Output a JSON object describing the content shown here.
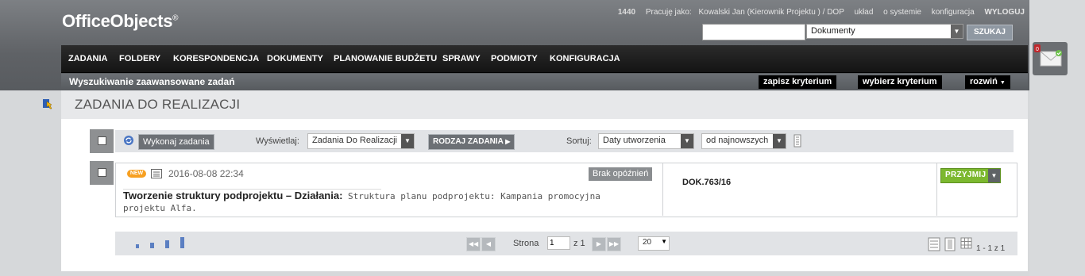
{
  "app": {
    "logo": "OfficeObjects",
    "logo_mark": "®"
  },
  "userbar": {
    "count": "1440",
    "working_as_label": "Pracuję jako:",
    "user": "Kowalski Jan (Kierownik Projektu ) / DOP",
    "layout": "układ",
    "about": "o systemie",
    "config": "konfiguracja",
    "logout": "WYLOGUJ"
  },
  "search": {
    "input_value": "",
    "scope_selected": "Dokumenty",
    "button": "SZUKAJ"
  },
  "nav": {
    "items": [
      "ZADANIA",
      "FOLDERY",
      "KORESPONDENCJA",
      "DOKUMENTY",
      "PLANOWANIE BUDŻETU",
      "SPRAWY",
      "PODMIOTY",
      "KONFIGURACJA"
    ]
  },
  "subbar": {
    "title": "Wyszukiwanie zaawansowane zadań",
    "save_criteria": "zapisz kryterium",
    "choose_criteria": "wybierz kryterium",
    "expand": "rozwiń"
  },
  "notifications": {
    "count": "0"
  },
  "page": {
    "title": "ZADANIA DO REALIZACJI"
  },
  "toolbar": {
    "execute_button": "Wykonaj zadania",
    "display_label": "Wyświetlaj:",
    "display_selected": "Zadania Do Realizacji",
    "task_type_button": "RODZAJ ZADANIA",
    "sort_label": "Sortuj:",
    "sort_by_selected": "Daty utworzenia",
    "sort_order_selected": "od najnowszych"
  },
  "tasks": [
    {
      "badge": "NEW",
      "date": "2016-08-08 22:34",
      "delay_status": "Brak opóźnień",
      "title": "Tworzenie struktury podprojektu – Działania:",
      "description": " Struktura planu podprojektu: Kampania promocyjna projektu Alfa.",
      "doc_ref": "DOK.763/16",
      "action": "PRZYJMIJ"
    }
  ],
  "pager": {
    "page_label": "Strona",
    "page_value": "1",
    "of_label": "z 1",
    "per_page_selected": "20",
    "summary": "1 - 1 z 1"
  },
  "colors": {
    "accept_green": "#7cb82f",
    "new_badge_orange": "#f7a021",
    "nav_black": "#1a1a1a"
  }
}
